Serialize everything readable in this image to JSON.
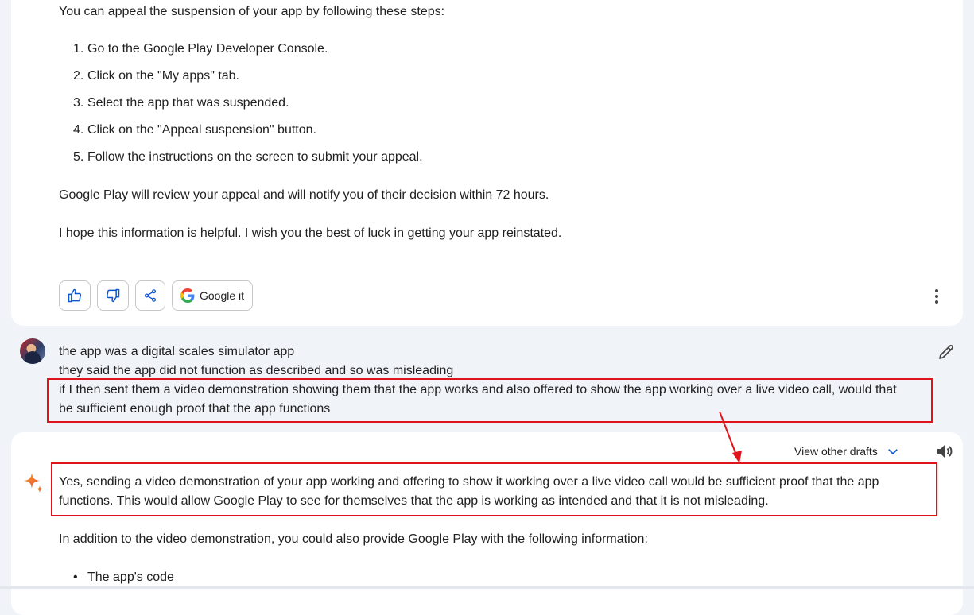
{
  "prev_response": {
    "intro": "You can appeal the suspension of your app by following these steps:",
    "steps": [
      {
        "num": "1.",
        "text": "Go to the Google Play Developer Console."
      },
      {
        "num": "2.",
        "text": "Click on the \"My apps\" tab."
      },
      {
        "num": "3.",
        "text": "Select the app that was suspended."
      },
      {
        "num": "4.",
        "text": "Click on the \"Appeal suspension\" button."
      },
      {
        "num": "5.",
        "text": "Follow the instructions on the screen to submit your appeal."
      }
    ],
    "review_note": "Google Play will review your appeal and will notify you of their decision within 72 hours.",
    "closing": "I hope this information is helpful. I wish you the best of luck in getting your app reinstated.",
    "actions": {
      "thumbs_up_icon": "thumbs-up-icon",
      "thumbs_down_icon": "thumbs-down-icon",
      "share_icon": "share-icon",
      "google_it_label": "Google it"
    }
  },
  "user_prompt": {
    "lines": [
      "the app was a digital scales simulator app",
      "they said the app did not function as described and so was misleading",
      "if I then sent them a video demonstration showing them that the app works and also offered to show the app working over a live video call, would that",
      "be sufficient enough proof that the app functions"
    ]
  },
  "response": {
    "view_drafts_label": "View other drafts",
    "answer_lines": [
      "Yes, sending a video demonstration of your app working and offering to show it working over a live video call would be sufficient proof that the app",
      "functions. This would allow Google Play to see for themselves that the app is working as intended and that it is not misleading."
    ],
    "addition": "In addition to the video demonstration, you could also provide Google Play with the following information:",
    "bullets": [
      "The app's code"
    ]
  },
  "colors": {
    "page_bg": "#f0f4f9",
    "card_bg": "#ffffff",
    "highlight": "#e0131a",
    "accent_blue": "#0b57d0"
  }
}
